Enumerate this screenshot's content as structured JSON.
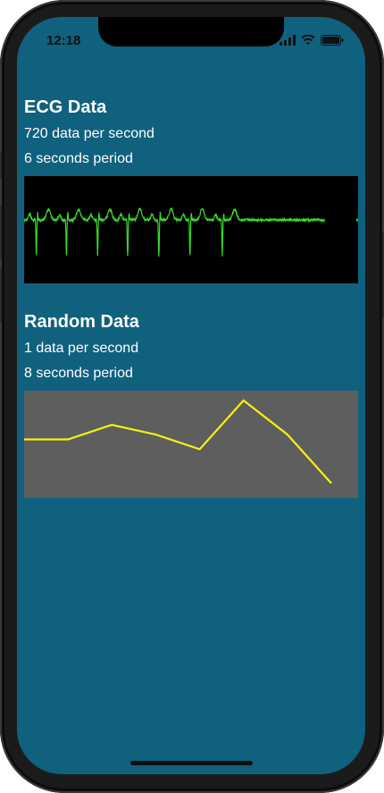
{
  "status_bar": {
    "time": "12:18"
  },
  "sections": [
    {
      "title": "ECG Data",
      "rate": "720 data per second",
      "period": "6 seconds period"
    },
    {
      "title": "Random Data",
      "rate": "1 data per second",
      "period": "8 seconds period"
    }
  ],
  "colors": {
    "screen_bg": "#0f617e",
    "ecg_bg": "#000000",
    "ecg_line": "#3ad82c",
    "random_bg": "#5e5e5e",
    "random_line": "#f7f011"
  },
  "chart_data": [
    {
      "type": "line",
      "title": "",
      "series": [
        {
          "values": []
        }
      ],
      "ecg_beat_positions_seconds": [
        0.22,
        0.76,
        1.32,
        1.86,
        2.42,
        2.98,
        3.56
      ],
      "gap_seconds": [
        5.4,
        6.0
      ],
      "xlim": [
        0,
        6
      ],
      "grid": false
    },
    {
      "type": "line",
      "title": "",
      "x": [
        0,
        1,
        2,
        3,
        4,
        5,
        6,
        7
      ],
      "series": [
        {
          "values": [
            0.6,
            0.6,
            0.75,
            0.65,
            0.5,
            1.0,
            0.65,
            0.15
          ]
        }
      ],
      "ylim": [
        0,
        1.1
      ],
      "grid": false
    }
  ]
}
